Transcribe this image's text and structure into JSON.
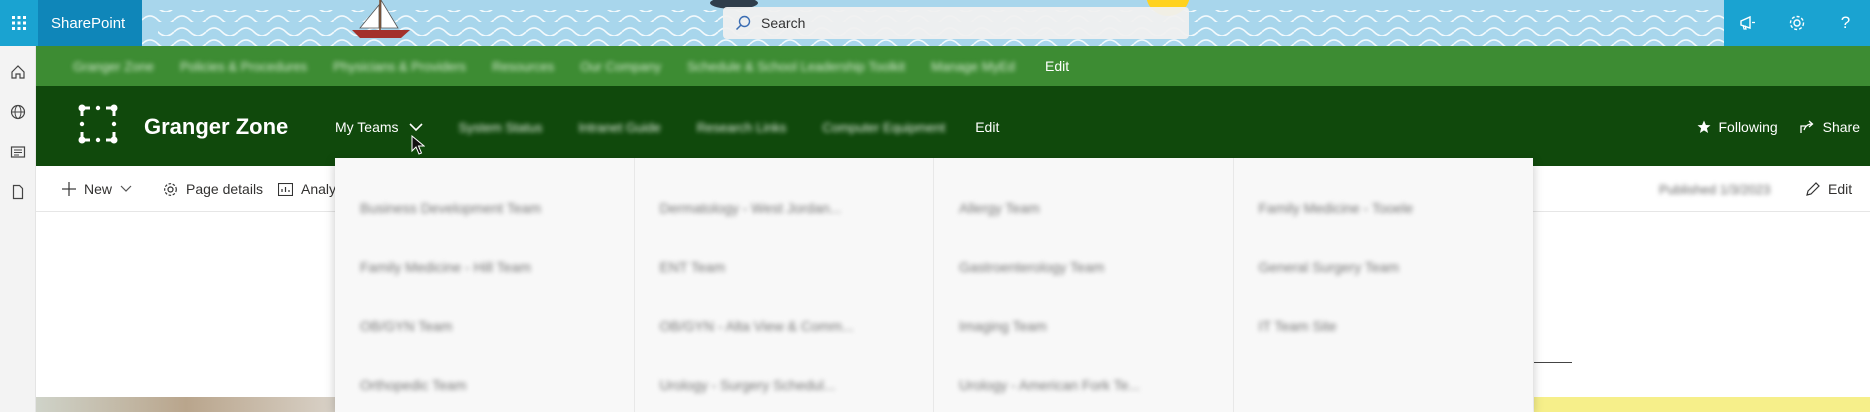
{
  "suite_bar": {
    "brand": "SharePoint",
    "search_placeholder": "Search"
  },
  "hub_nav": {
    "items": [
      "Granger Zone",
      "Policies & Procedures",
      "Physicians & Providers",
      "Resources",
      "Our Company",
      "Schedule & School Leadership Toolkit",
      "Manage MyEd"
    ],
    "edit_label": "Edit"
  },
  "site_header": {
    "title": "Granger Zone",
    "nav": {
      "my_teams": "My Teams",
      "blurred_items": [
        "System Status",
        "Intranet Guide",
        "Research Links",
        "Computer Equipment"
      ],
      "edit": "Edit"
    },
    "following": "Following",
    "share": "Share"
  },
  "command_bar": {
    "new": "New",
    "page_details": "Page details",
    "analytics": "Analy",
    "published": "Published 1/3/2023",
    "edit": "Edit"
  },
  "mega_menu": {
    "columns": [
      [
        "Business Development Team",
        "Family Medicine - Hill Team",
        "OB/GYN Team",
        "Orthopedic Team"
      ],
      [
        "Dermatology - West Jordan...",
        "ENT Team",
        "OB/GYN - Alta View & Comm...",
        "Urology - Surgery Schedul..."
      ],
      [
        "Allergy Team",
        "Gastroenterology Team",
        "Imaging Team",
        "Urology - American Fork Te..."
      ],
      [
        "Family Medicine - Tooele",
        "General Surgery Team",
        "IT Team Site"
      ]
    ]
  },
  "colors": {
    "hub_green": "#3d8c33",
    "header_green": "#10490c",
    "suite_blue": "#1aa3d1"
  }
}
